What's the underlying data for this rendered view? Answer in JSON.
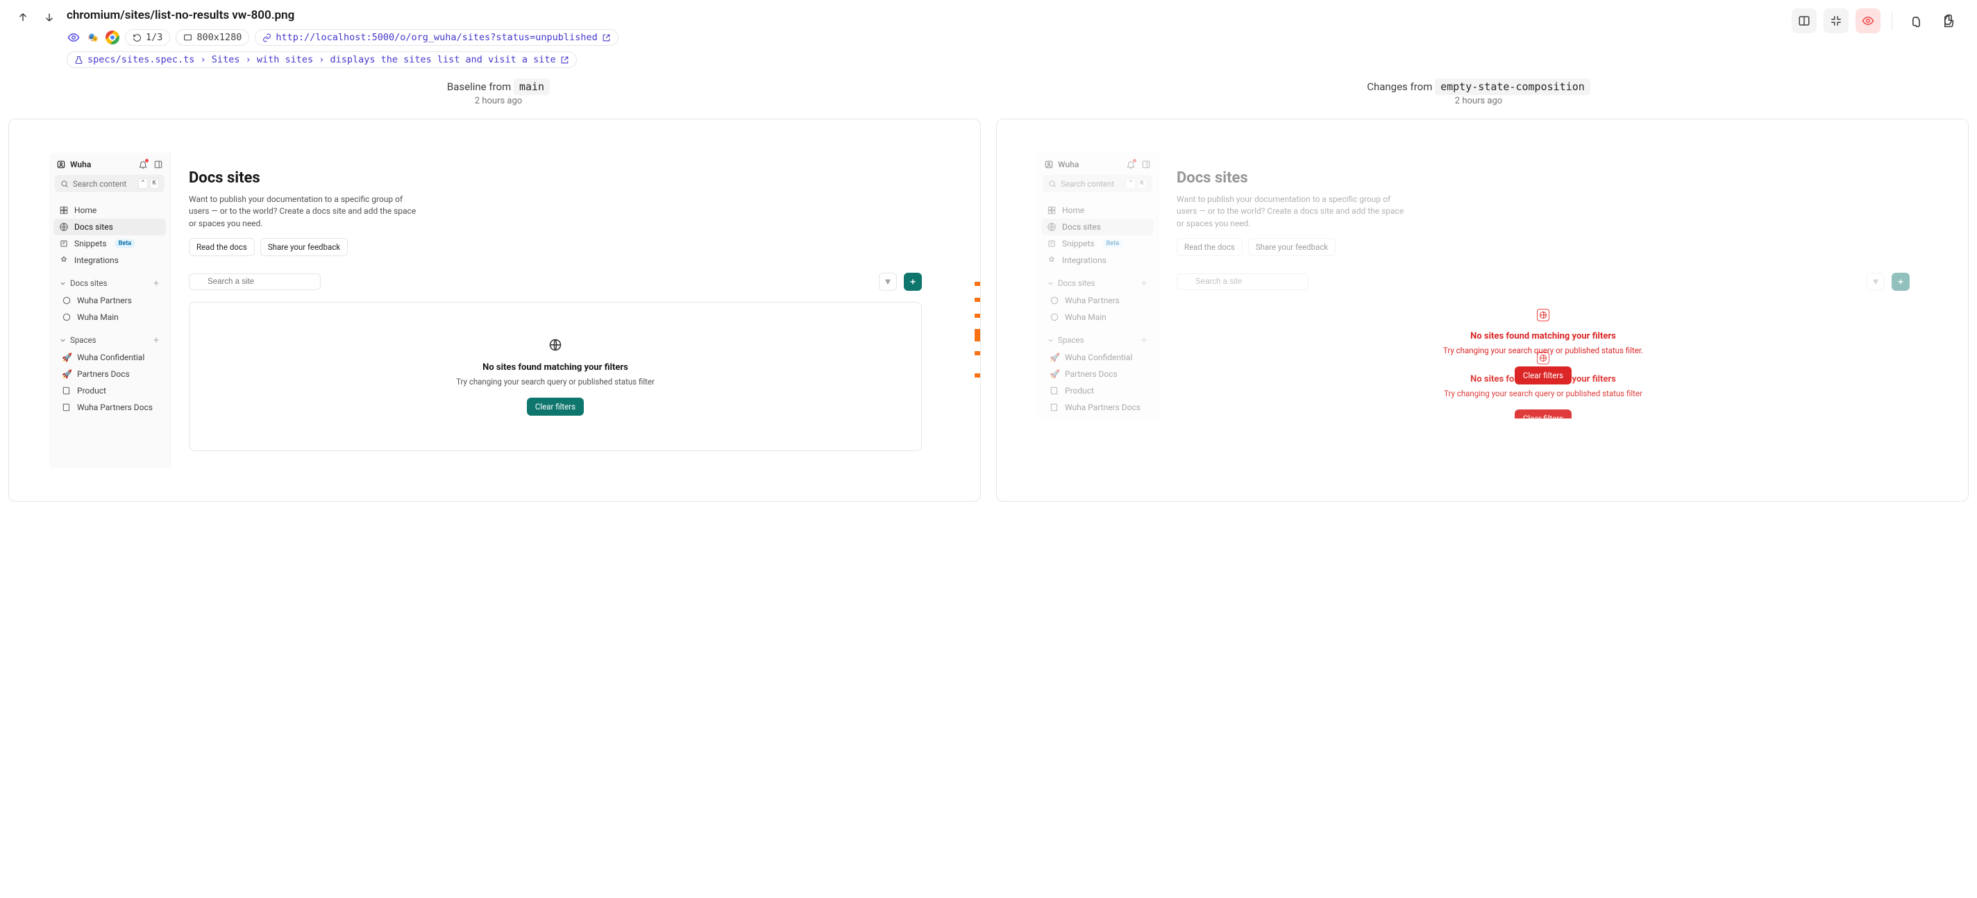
{
  "header": {
    "title": "chromium/sites/list-no-results vw-800.png",
    "attempt": "1/3",
    "viewport": "800x1280",
    "url": "http://localhost:5000/o/org_wuha/sites?status=unpublished",
    "spec": "specs/sites.spec.ts › Sites › with sites › displays the sites list and visit a site"
  },
  "compare": {
    "baseline_label": "Baseline from",
    "baseline_branch": "main",
    "baseline_time": "2 hours ago",
    "changes_label": "Changes from",
    "changes_branch": "empty-state-composition",
    "changes_time": "2 hours ago"
  },
  "app": {
    "org": "Wuha",
    "search_placeholder": "Search content",
    "search_kbd1": "^",
    "search_kbd2": "K",
    "nav": {
      "home": "Home",
      "docs_sites": "Docs sites",
      "snippets": "Snippets",
      "snippets_badge": "Beta",
      "integrations": "Integrations"
    },
    "section_sites": {
      "title": "Docs sites",
      "items": [
        "Wuha Partners",
        "Wuha Main"
      ]
    },
    "section_spaces": {
      "title": "Spaces",
      "items": [
        "Wuha Confidential",
        "Partners Docs",
        "Product",
        "Wuha Partners Docs"
      ]
    },
    "content": {
      "heading": "Docs sites",
      "description": "Want to publish your documentation to a specific group of users — or to the world? Create a docs site and add the space or spaces you need.",
      "btn_read": "Read the docs",
      "btn_feedback": "Share your feedback",
      "search_site_placeholder": "Search a site"
    },
    "empty": {
      "title": "No sites found matching your filters",
      "subtitle_baseline": "Try changing your search query or published status filter",
      "subtitle_changes": "Try changing your search query or published status filter.",
      "button": "Clear filters"
    }
  },
  "colors": {
    "primary": "#0f766e",
    "diff_highlight": "#dc2626"
  }
}
